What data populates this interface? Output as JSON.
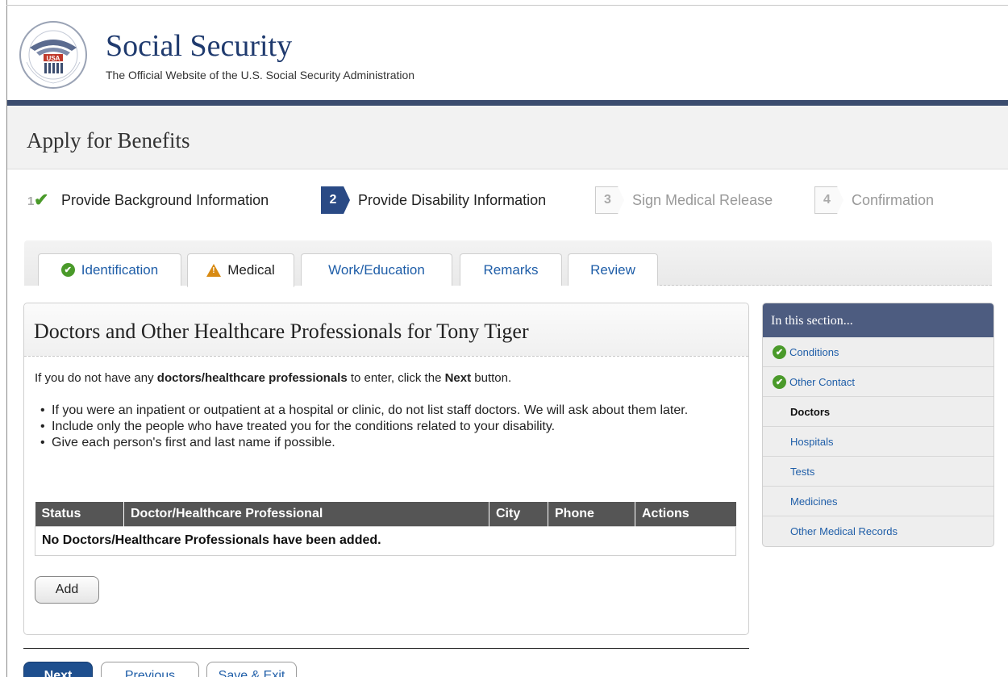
{
  "header": {
    "site_title": "Social Security",
    "site_subtitle": "The Official Website of the U.S. Social Security Administration",
    "seal_text": "SOCIAL SECURITY ADMINISTRATION USA"
  },
  "apply": {
    "title": "Apply for Benefits"
  },
  "steps": [
    {
      "number": "1",
      "label": "Provide Background Information",
      "state": "done"
    },
    {
      "number": "2",
      "label": "Provide Disability Information",
      "state": "current"
    },
    {
      "number": "3",
      "label": "Sign Medical Release",
      "state": "future"
    },
    {
      "number": "4",
      "label": "Confirmation",
      "state": "future"
    }
  ],
  "tabs": [
    {
      "label": "Identification",
      "icon": "check-circle-icon"
    },
    {
      "label": "Medical",
      "icon": "warning-icon"
    },
    {
      "label": "Work/Education"
    },
    {
      "label": "Remarks"
    },
    {
      "label": "Review"
    }
  ],
  "main": {
    "title": "Doctors and Other Healthcare Professionals for Tony Tiger",
    "intro_prefix": "If you do not have any ",
    "intro_bold": "doctors/healthcare professionals",
    "intro_middle": " to enter, click the ",
    "intro_bold2": "Next",
    "intro_suffix": " button.",
    "bullets": [
      "If you were an inpatient or outpatient at a hospital or clinic, do not list staff doctors. We will ask about them later.",
      "Include only the people who have treated you for the conditions related to your disability.",
      "Give each person's first and last name if possible."
    ],
    "table": {
      "headers": [
        "Status",
        "Doctor/Healthcare Professional",
        "City",
        "Phone",
        "Actions"
      ],
      "empty_message": "No Doctors/Healthcare Professionals have been added."
    },
    "add_label": "Add"
  },
  "footer_buttons": {
    "next": "Next",
    "previous": "Previous",
    "save_exit": "Save & Exit"
  },
  "sidebar": {
    "title": "In this section...",
    "items": [
      {
        "label": "Conditions",
        "state": "done"
      },
      {
        "label": "Other Contact",
        "state": "done"
      },
      {
        "label": "Doctors",
        "state": "current"
      },
      {
        "label": "Hospitals",
        "state": "todo"
      },
      {
        "label": "Tests",
        "state": "todo"
      },
      {
        "label": "Medicines",
        "state": "todo"
      },
      {
        "label": "Other Medical Records",
        "state": "todo"
      }
    ]
  },
  "colors": {
    "brand_navy": "#1f3a6e",
    "header_bar": "#3c4d6f",
    "step_current": "#2a4a85",
    "check_green": "#4a9a2a",
    "warning_orange": "#d88a12",
    "link_blue": "#1f5ea8",
    "table_header": "#555555",
    "sidebar_header": "#4d5c80",
    "next_button": "#1e4f8e"
  }
}
